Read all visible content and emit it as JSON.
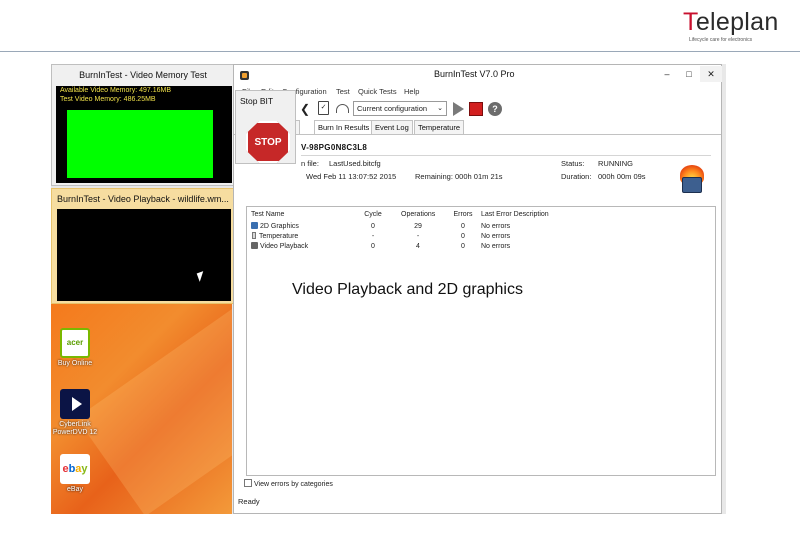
{
  "logo": {
    "first_letter": "T",
    "rest": "eleplan",
    "tagline": "Lifecycle care for electronics"
  },
  "video_memory_window": {
    "title": "BurnInTest - Video Memory Test",
    "available": "Available Video Memory: 497.16MB",
    "test": "Test Video Memory: 486.25MB",
    "fill_color": "#00ff00"
  },
  "video_playback_window": {
    "title": "BurnInTest - Video Playback - wildlife.wm..."
  },
  "desktop": {
    "icons": [
      {
        "label": "Buy Online",
        "icon": "acer-icon",
        "glyph": "acer"
      },
      {
        "label": "CyberLink PowerDVD 12",
        "icon": "cyberlink-icon"
      },
      {
        "label": "eBay",
        "icon": "ebay-icon"
      }
    ]
  },
  "burnin_window": {
    "title": "BurnInTest V7.0 Pro",
    "menu": [
      "File",
      "Edit",
      "Configuration",
      "Test",
      "Quick Tests",
      "Help"
    ],
    "toolbar": {
      "config_select": "Current configuration"
    },
    "tabs": [
      "n",
      "Burn In Results",
      "Event Log",
      "Temperature"
    ],
    "machine_id": "V-98PG0N8C3L8",
    "info": {
      "config_file_label": "n file:",
      "config_file": "LastUsed.bitcfg",
      "start_time": "Wed Feb 11 13:07:52 2015",
      "remaining_label": "Remaining:",
      "remaining": "000h 01m 21s",
      "status_label": "Status:",
      "status": "RUNNING",
      "duration_label": "Duration:",
      "duration": "000h 00m 09s"
    },
    "results": {
      "headers": [
        "Test Name",
        "Cycle",
        "Operations",
        "Errors",
        "Last Error Description"
      ],
      "rows": [
        {
          "name": "2D Graphics",
          "cycle": "0",
          "operations": "29",
          "errors": "0",
          "last_error": "No errors"
        },
        {
          "name": "Temperature",
          "cycle": "-",
          "operations": "-",
          "errors": "0",
          "last_error": "No errors"
        },
        {
          "name": "Video Playback",
          "cycle": "0",
          "operations": "4",
          "errors": "0",
          "last_error": "No errors"
        }
      ]
    },
    "view_errors_label": "View errors by categories",
    "status_bar": "Ready"
  },
  "stop_bit_window": {
    "title": "Stop BIT",
    "button": "STOP",
    "button_color": "#c62828"
  },
  "caption": "Video Playback and 2D graphics",
  "accent_color": "#c8102e"
}
